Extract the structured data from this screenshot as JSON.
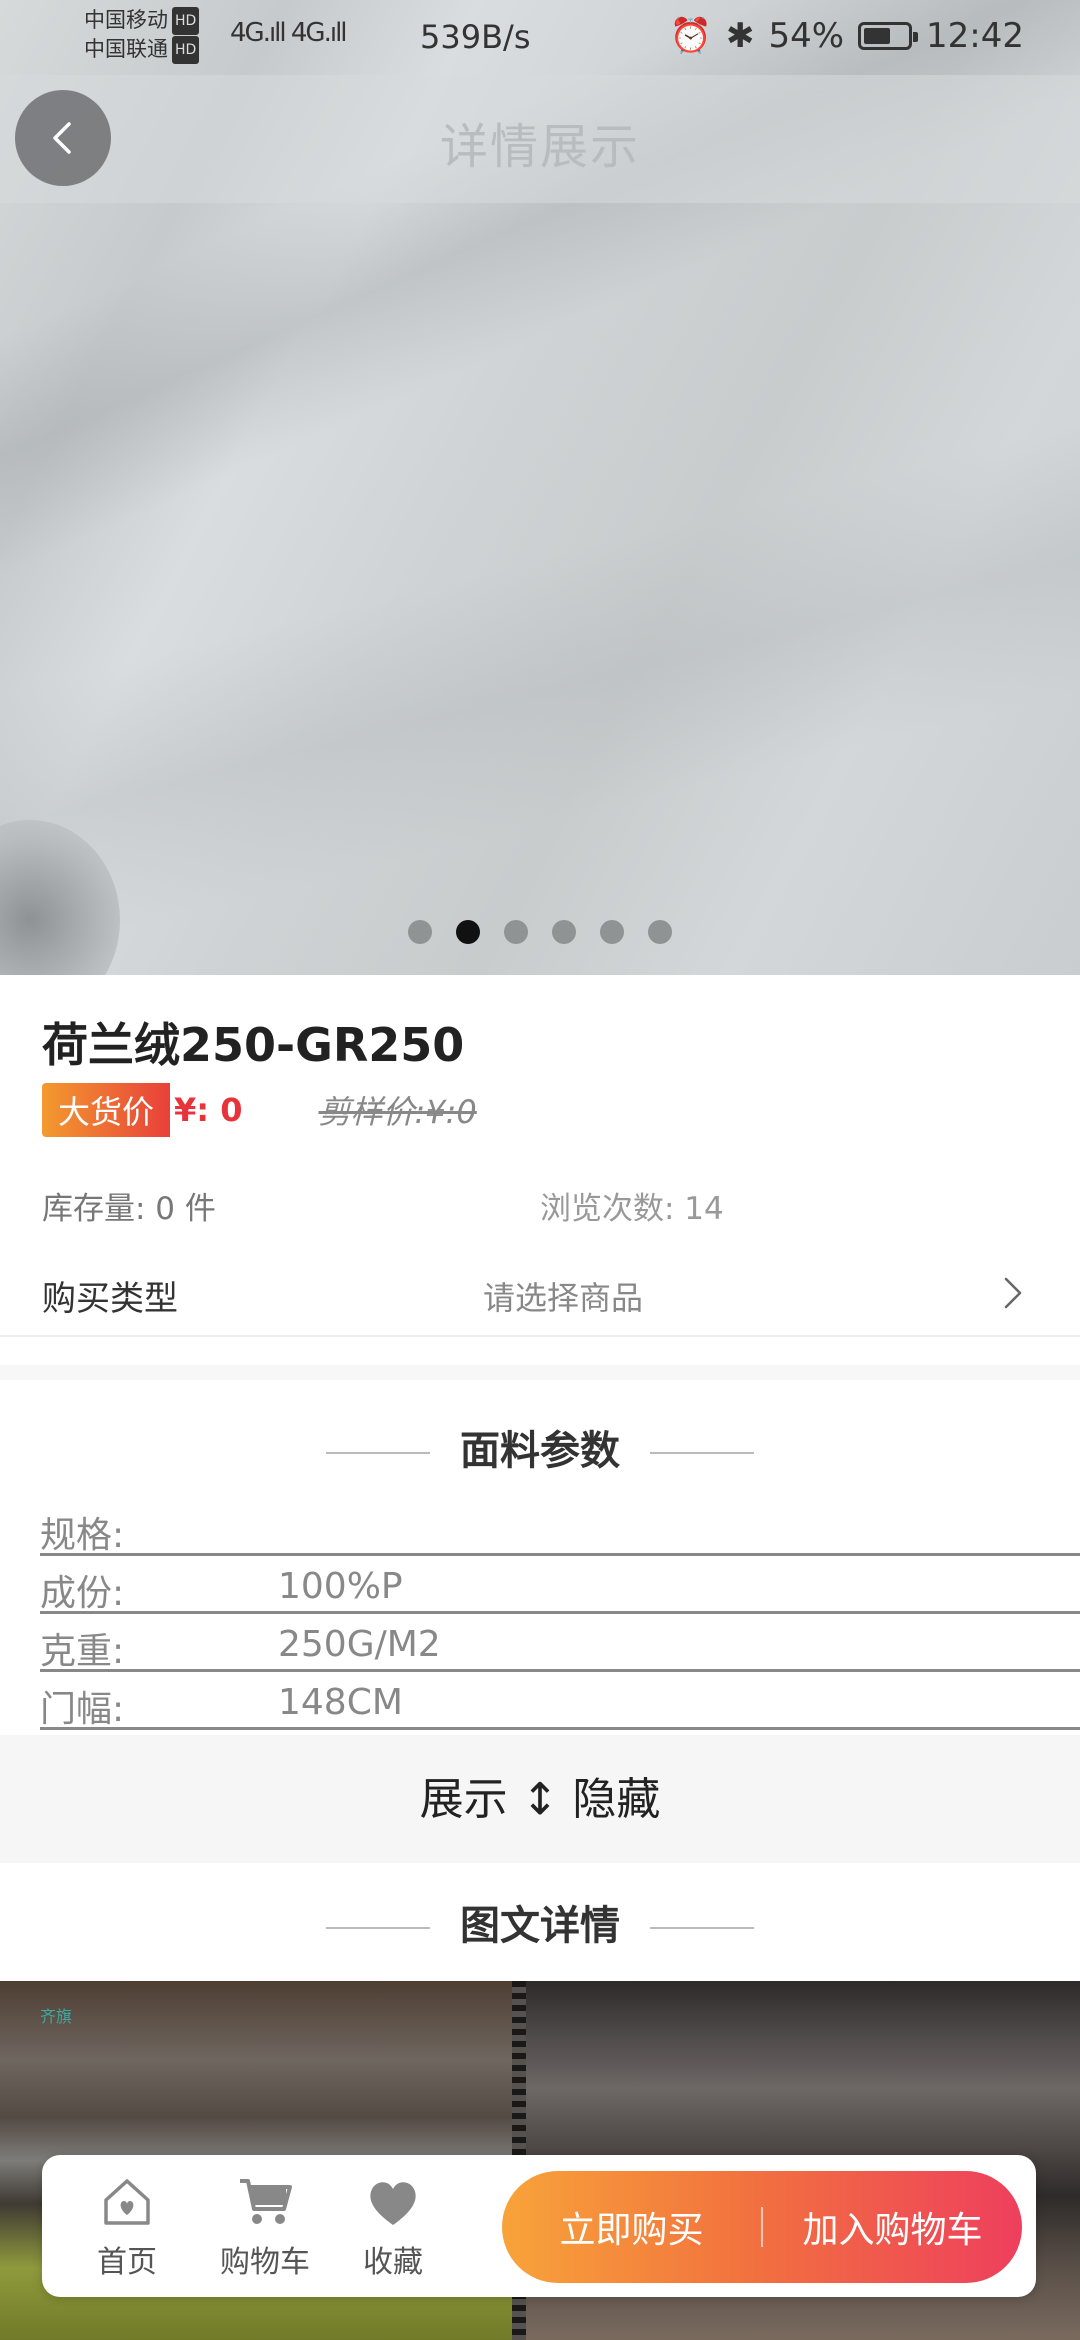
{
  "status_bar": {
    "carrier1": "中国移动",
    "carrier2": "中国联通",
    "hd": "HD",
    "signal": "4G.ıll 4G.ıll",
    "speed": "539B/s",
    "battery": "54%",
    "time": "12:42"
  },
  "header": {
    "title": "详情展示"
  },
  "carousel": {
    "count": 6,
    "active_index": 1
  },
  "product": {
    "name": "荷兰绒250-GR250",
    "price_tag": "大货价",
    "price": "¥: 0",
    "sample_price": "剪样价:¥:0",
    "stock": "库存量: 0 件",
    "views": "浏览次数: 14",
    "buy_type_label": "购买类型",
    "buy_type_value": "请选择商品"
  },
  "params": {
    "title": "面料参数",
    "rows": [
      {
        "key": "规格:",
        "value": ""
      },
      {
        "key": "成份:",
        "value": "100%P"
      },
      {
        "key": "克重:",
        "value": "250G/M2"
      },
      {
        "key": "门幅:",
        "value": "148CM"
      }
    ],
    "toggle": "展示 ↕ 隐藏"
  },
  "detail": {
    "title": "图文详情",
    "image_mark": "齐旗"
  },
  "bottom_bar": {
    "home": "首页",
    "cart": "购物车",
    "favorite": "收藏",
    "buy_now": "立即购买",
    "add_cart": "加入购物车"
  },
  "colors": {
    "accent_start": "#f8a33a",
    "accent_end": "#ee3f5d",
    "price_red": "#e8333b"
  }
}
